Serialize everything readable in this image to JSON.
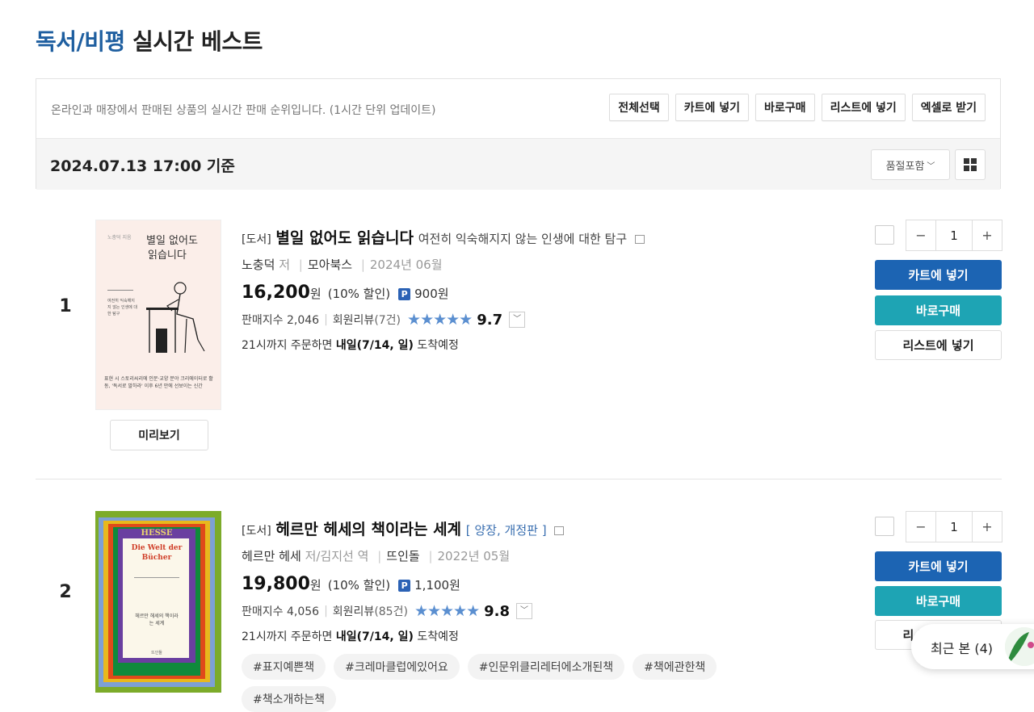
{
  "header": {
    "category": "독서/비평",
    "title_rest": " 실시간 베스트"
  },
  "info": {
    "description": "온라인과 매장에서 판매된 상품의 실시간 판매 순위입니다. (1시간 단위 업데이트)",
    "buttons": [
      "전체선택",
      "카트에 넣기",
      "바로구매",
      "리스트에 넣기",
      "엑셀로 받기"
    ],
    "date": "2024.07.13  17:00  기준",
    "filter": "품절포함"
  },
  "actions": {
    "cart": "카트에 넣기",
    "buy": "바로구매",
    "list": "리스트에 넣기",
    "preview": "미리보기",
    "minus": "−",
    "plus": "+"
  },
  "items": [
    {
      "rank": "1",
      "tag": "[도서]",
      "title": "별일 없어도 읽습니다",
      "subtitle": "여전히 익숙해지지 않는 인생에 대한 탐구",
      "author": "노충덕",
      "author_role": "저",
      "publisher": "모아북스",
      "date": "2024년 06월",
      "price": "16,200",
      "won": "원",
      "discount": "(10% 할인)",
      "point_label": "P",
      "points": "900원",
      "sales": "판매지수 2,046",
      "review_label": "회원리뷰",
      "review_count": "(7건)",
      "stars": "★★★★★",
      "rating": "9.7",
      "delivery_pre": "21시까지 주문하면",
      "delivery_day": "내일(7/14, 일)",
      "delivery_post": "도착예정",
      "qty": "1",
      "cover": {
        "title_line1": "별일 없어도",
        "title_line2": "읽습니다",
        "small": "노충덕 지음",
        "blurb": "여전히 익숙해지지 않는 인생에 대한 탐구",
        "bottom": "표현 시 스토리씨리에 인문·교양 분야 크리에이터로 활동, '독서로 말하라' 이후 6년 만에 선보이는 신간"
      }
    },
    {
      "rank": "2",
      "tag": "[도서]",
      "title": "헤르만 헤세의 책이라는 세계",
      "subtitle": "[ 양장, 개정판 ]",
      "author": "헤르만 헤세",
      "author_role": "저/김지선",
      "translator_role": "역",
      "publisher": "뜨인돌",
      "date": "2022년 05월",
      "price": "19,800",
      "won": "원",
      "discount": "(10% 할인)",
      "point_label": "P",
      "points": "1,100원",
      "sales": "판매지수 4,056",
      "review_label": "회원리뷰",
      "review_count": "(85건)",
      "stars": "★★★★★",
      "rating": "9.8",
      "delivery_pre": "21시까지 주문하면",
      "delivery_day": "내일(7/14, 일)",
      "delivery_post": "도착예정",
      "qty": "1",
      "tags": [
        "#표지예쁜책",
        "#크레마클럽에있어요",
        "#인문위클리레터에소개된책",
        "#책에관한책",
        "#책소개하는책"
      ],
      "cover": {
        "brand": "HESSE",
        "de_title": "Die Welt der Bücher",
        "kr_title": "헤르만 헤세의 책이라는 세계",
        "pub": "뜨인돌"
      }
    }
  ],
  "recent": {
    "label": "최근 본 (4)"
  }
}
